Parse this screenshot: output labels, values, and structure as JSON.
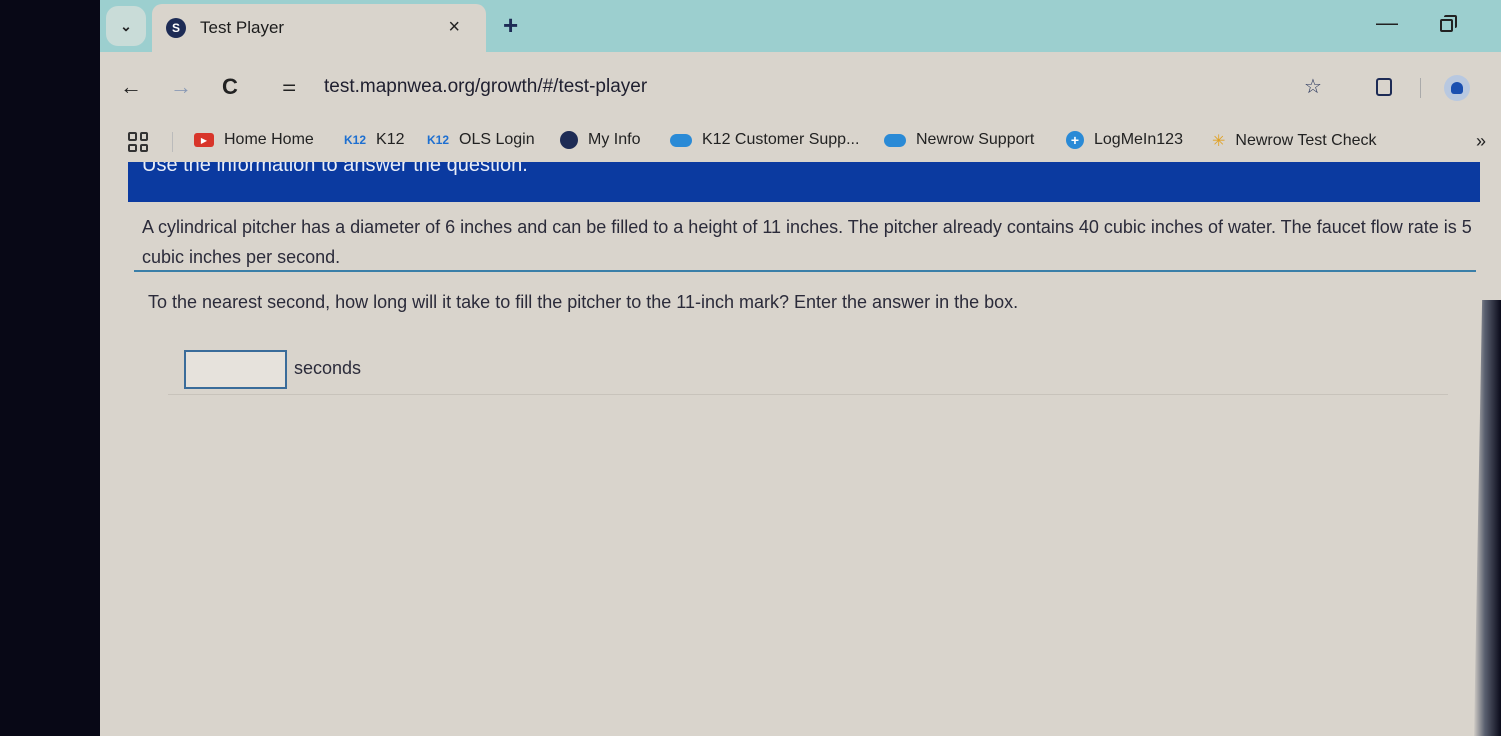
{
  "browser": {
    "tab": {
      "title": "Test Player",
      "close": "×"
    },
    "new_tab": "+",
    "tab_search": "⌄",
    "window_min": "—",
    "nav": {
      "back": "←",
      "forward": "→",
      "reload": "C",
      "site_info": "⚌"
    },
    "url": "test.mapnwea.org/growth/#/test-player",
    "star": "☆",
    "bookmarks": [
      {
        "label": "Home Home",
        "icon": "youtube-icon",
        "glyph": "▶"
      },
      {
        "label": "K12",
        "icon": "k12-icon",
        "glyph": "K12"
      },
      {
        "label": "OLS Login",
        "icon": "k12-icon",
        "glyph": "K12"
      },
      {
        "label": "My Info",
        "icon": "globe-icon",
        "glyph": ""
      },
      {
        "label": "K12 Customer Supp...",
        "icon": "salesforce-icon",
        "glyph": ""
      },
      {
        "label": "Newrow Support",
        "icon": "salesforce-icon",
        "glyph": ""
      },
      {
        "label": "LogMeIn123",
        "icon": "logmein-icon",
        "glyph": "+"
      },
      {
        "label": "Newrow Test Check",
        "icon": "newrow-icon",
        "glyph": "✳"
      }
    ],
    "bookmarks_more": "»"
  },
  "test": {
    "banner": "Use the information to answer the question.",
    "passage": "A cylindrical pitcher has a diameter of 6 inches and can be filled to a height of 11 inches. The pitcher already contains 40 cubic inches of water. The faucet flow rate is 5 cubic inches per second.",
    "question": "To the nearest second, how long will it take to fill the pitcher to the 11-inch mark? Enter the answer in the box.",
    "answer": {
      "value": "",
      "unit": "seconds"
    }
  }
}
